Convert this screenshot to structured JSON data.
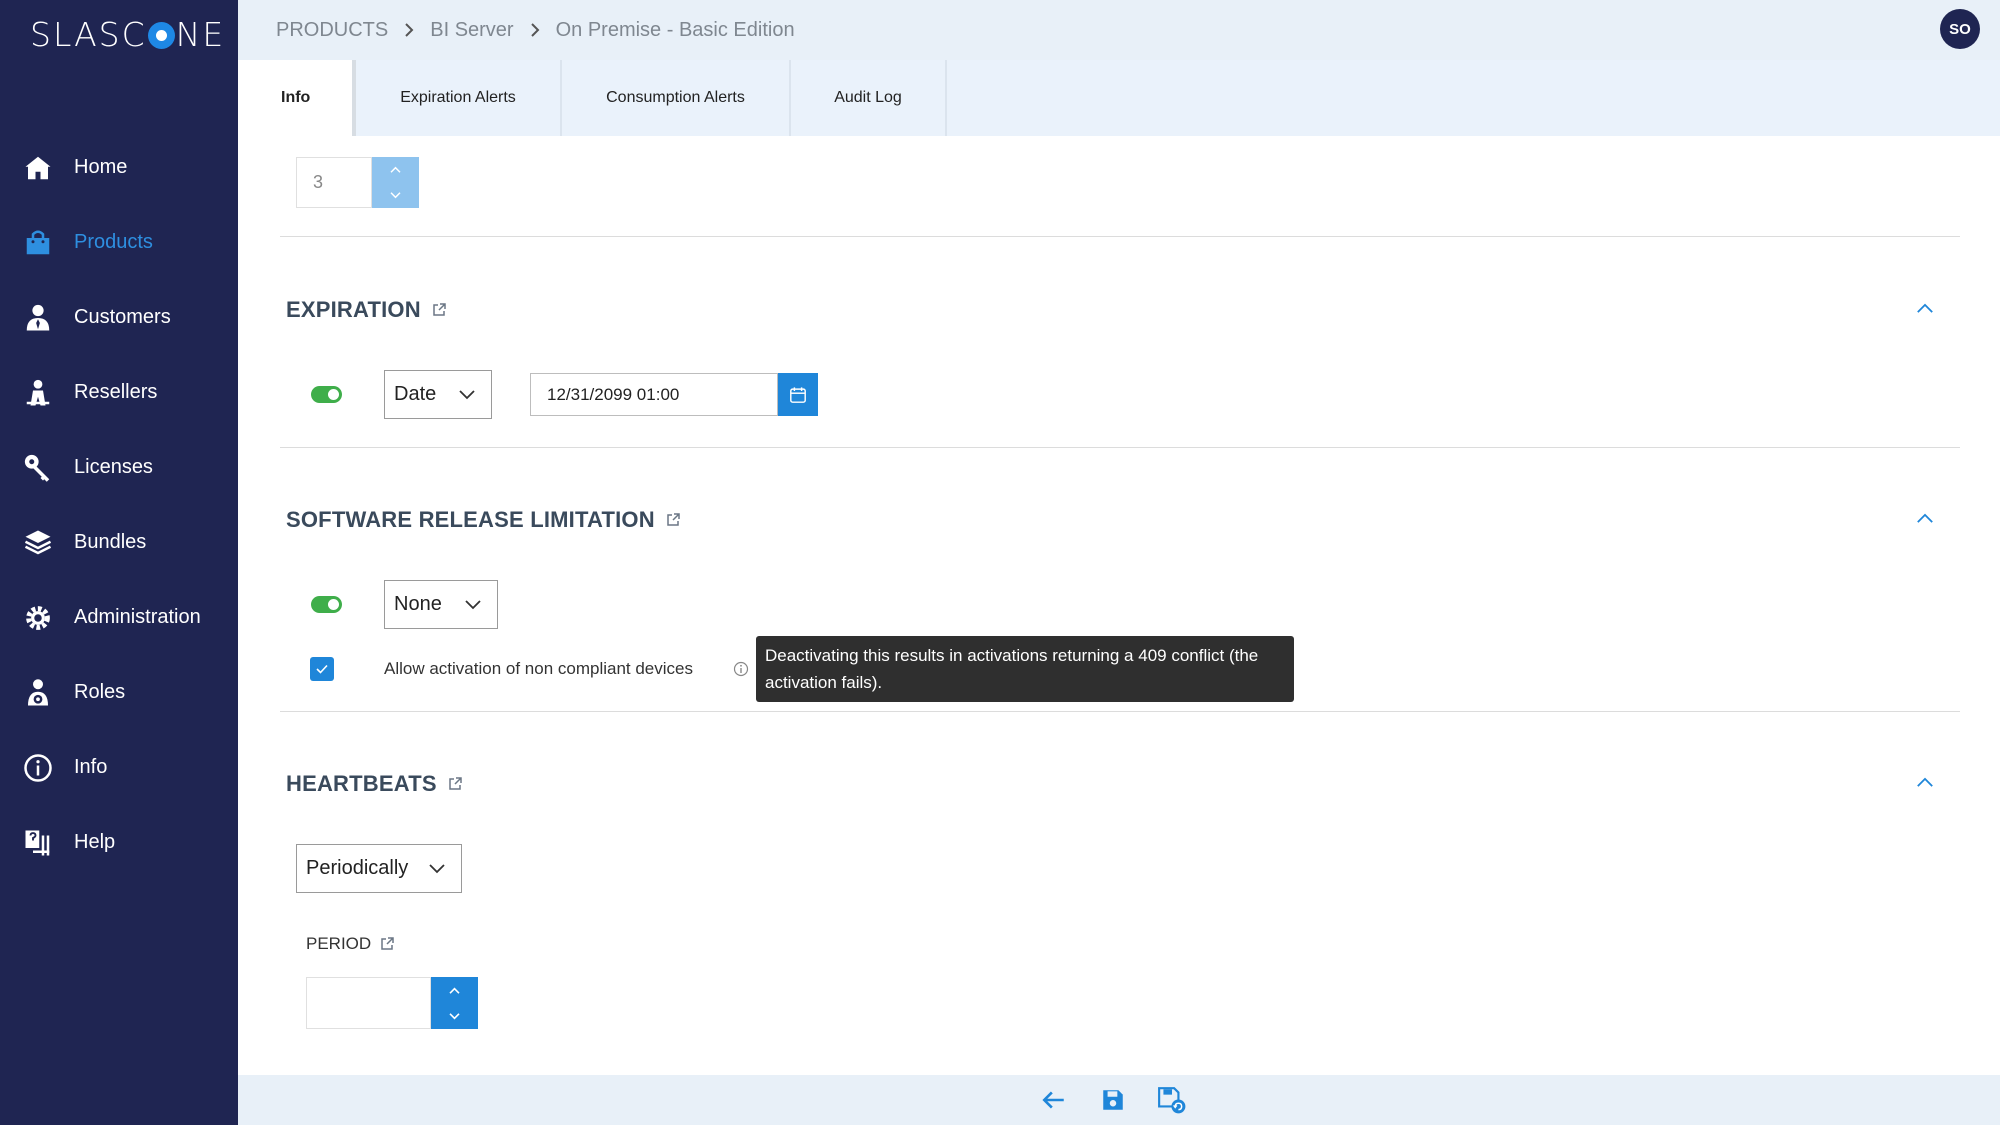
{
  "app": {
    "logo_text_a": "SLASC",
    "logo_text_b": "NE"
  },
  "sidebar": {
    "items": [
      {
        "label": "Home",
        "icon": "home-icon"
      },
      {
        "label": "Products",
        "icon": "shopping-bag-icon",
        "active": true
      },
      {
        "label": "Customers",
        "icon": "customer-icon"
      },
      {
        "label": "Resellers",
        "icon": "reseller-icon"
      },
      {
        "label": "Licenses",
        "icon": "key-icon"
      },
      {
        "label": "Bundles",
        "icon": "layers-icon"
      },
      {
        "label": "Administration",
        "icon": "gear-icon"
      },
      {
        "label": "Roles",
        "icon": "roles-icon"
      },
      {
        "label": "Info",
        "icon": "info-icon"
      },
      {
        "label": "Help",
        "icon": "help-icon"
      }
    ]
  },
  "header": {
    "breadcrumb": [
      "PRODUCTS",
      "BI Server",
      "On Premise - Basic Edition"
    ],
    "avatar": "SO"
  },
  "tabs": [
    "Info",
    "Expiration Alerts",
    "Consumption Alerts",
    "Audit Log"
  ],
  "top_stepper": {
    "value": "3"
  },
  "expiration": {
    "title": "EXPIRATION",
    "mode": "Date",
    "date_value": "12/31/2099 01:00"
  },
  "software_release": {
    "title": "SOFTWARE RELEASE LIMITATION",
    "mode": "None",
    "checkbox_label": "Allow activation of non compliant devices",
    "tooltip": "Deactivating this results in activations returning a 409 conflict (the activation fails)."
  },
  "heartbeats": {
    "title": "HEARTBEATS",
    "mode": "Periodically",
    "period_label": "PERIOD",
    "period_value": ""
  },
  "colors": {
    "sidebar_bg": "#1f2552",
    "accent": "#1f86d9",
    "toggle_on": "#3fae4a",
    "header_bg": "#e8f0f8"
  }
}
